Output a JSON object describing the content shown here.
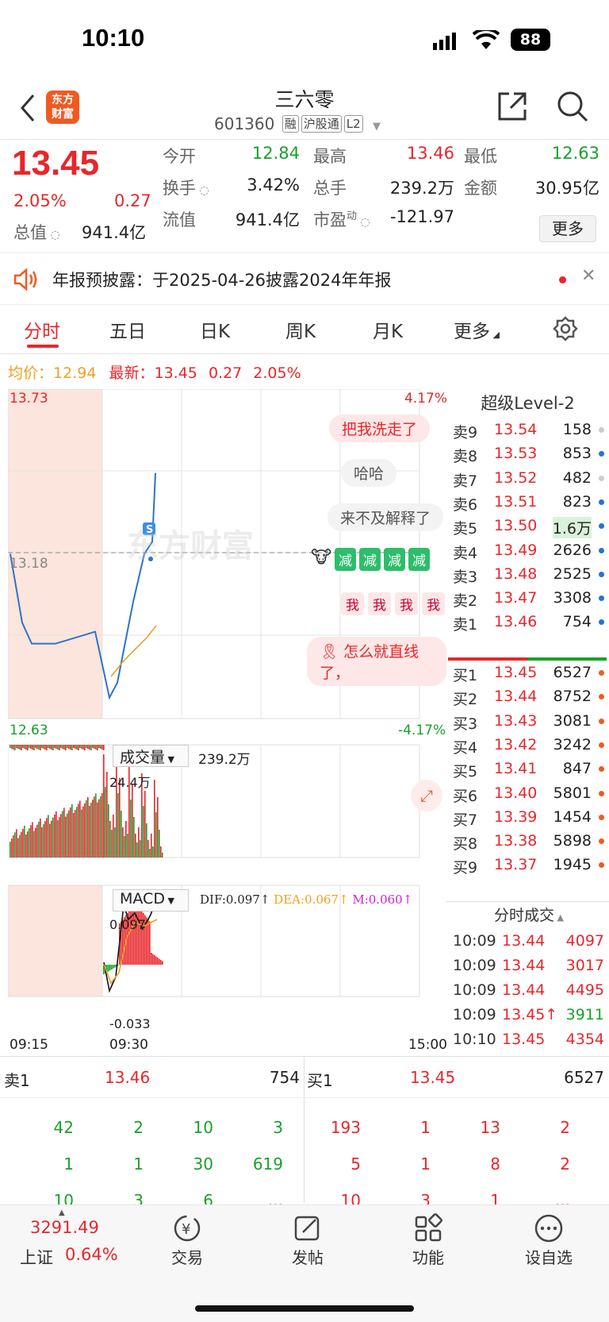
{
  "status": {
    "time": "10:10",
    "battery": "88"
  },
  "header": {
    "logo_line1": "东方",
    "logo_line2": "财富",
    "name": "三六零",
    "code": "601360",
    "tags": [
      "融",
      "沪股通",
      "L2"
    ]
  },
  "quote": {
    "price": "13.45",
    "pct": "2.05%",
    "change": "0.27",
    "stats": [
      {
        "label": "今开",
        "value": "12.84",
        "color": "#17a12b"
      },
      {
        "label": "最高",
        "value": "13.46",
        "color": "#e8262a"
      },
      {
        "label": "最低",
        "value": "12.63",
        "color": "#17a12b"
      },
      {
        "label": "换手",
        "value": "3.42%",
        "color": "#222"
      },
      {
        "label": "总手",
        "value": "239.2万",
        "color": "#222"
      },
      {
        "label": "金额",
        "value": "30.95亿",
        "color": "#222"
      },
      {
        "label": "总值",
        "value": "941.4亿",
        "color": "#222"
      },
      {
        "label": "流值",
        "value": "941.4亿",
        "color": "#222"
      },
      {
        "label": "市盈",
        "label_sup": "动",
        "value": "-121.97",
        "color": "#222"
      }
    ],
    "more": "更多"
  },
  "notice": {
    "text": "年报预披露：于2025-04-26披露2024年年报"
  },
  "tabs": [
    "分时",
    "五日",
    "日K",
    "周K",
    "月K",
    "更多"
  ],
  "avgline": {
    "avg_label": "均价：",
    "avg": "12.94",
    "last_label": "最新：",
    "last": "13.45",
    "chg": "0.27",
    "pct": "2.05%"
  },
  "chart": {
    "ymax": "13.73",
    "ymid": "13.18",
    "ymin": "12.63",
    "pmax": "4.17%",
    "pmin": "-4.17%",
    "vol_label": "成交量",
    "vol_total": "239.2万",
    "vol_max": "24.4万",
    "macd_label": "MACD",
    "dif": "DIF:0.097",
    "dea": "DEA:0.067",
    "m": "M:0.060",
    "macd_max": "0.097",
    "macd_min": "-0.033",
    "t_start": "09:15",
    "t_open": "09:30",
    "t_end": "15:00",
    "watermark": "东方财富",
    "comments": [
      "把我洗走了",
      "哈哈",
      "来不及解释了",
      "减",
      "减",
      "减",
      "减",
      "我",
      "我",
      "我",
      "我",
      "怎么就直线了，"
    ]
  },
  "level2": {
    "title": "超级Level-2",
    "asks": [
      [
        "卖9",
        "13.54",
        "158"
      ],
      [
        "卖8",
        "13.53",
        "853"
      ],
      [
        "卖7",
        "13.52",
        "482"
      ],
      [
        "卖6",
        "13.51",
        "823"
      ],
      [
        "卖5",
        "13.50",
        "1.6万"
      ],
      [
        "卖4",
        "13.49",
        "2626"
      ],
      [
        "卖3",
        "13.48",
        "2525"
      ],
      [
        "卖2",
        "13.47",
        "3308"
      ],
      [
        "卖1",
        "13.46",
        "754"
      ]
    ],
    "bids": [
      [
        "买1",
        "13.45",
        "6527"
      ],
      [
        "买2",
        "13.44",
        "8752"
      ],
      [
        "买3",
        "13.43",
        "3081"
      ],
      [
        "买4",
        "13.42",
        "3242"
      ],
      [
        "买5",
        "13.41",
        "847"
      ],
      [
        "买6",
        "13.40",
        "5801"
      ],
      [
        "买7",
        "13.39",
        "1454"
      ],
      [
        "买8",
        "13.38",
        "5898"
      ],
      [
        "买9",
        "13.37",
        "1945"
      ]
    ],
    "trades_title": "分时成交",
    "trades": [
      [
        "10:09",
        "13.44",
        "4097"
      ],
      [
        "10:09",
        "13.44",
        "3017"
      ],
      [
        "10:09",
        "13.44",
        "4495"
      ],
      [
        "10:09",
        "13.45↑",
        "3911"
      ],
      [
        "10:10",
        "13.45",
        "4354"
      ]
    ]
  },
  "queue": {
    "ask_label": "卖1",
    "ask_price": "13.46",
    "ask_vol": "754",
    "bid_label": "买1",
    "bid_price": "13.45",
    "bid_vol": "6527",
    "ask_rows": [
      [
        "42",
        "2",
        "10",
        "3"
      ],
      [
        "1",
        "1",
        "30",
        "619"
      ],
      [
        "10",
        "3",
        "6",
        "..."
      ]
    ],
    "bid_rows": [
      [
        "193",
        "1",
        "13",
        "2"
      ],
      [
        "5",
        "1",
        "8",
        "2"
      ],
      [
        "10",
        "3",
        "1",
        "..."
      ]
    ]
  },
  "nav": {
    "index_value": "3291.49",
    "index_name": "上证",
    "index_pct": "0.64%",
    "items": [
      "交易",
      "发帖",
      "功能",
      "设自选"
    ]
  },
  "colors": {
    "up": "#e8262a",
    "down": "#17a12b",
    "accent": "#ef5a23"
  },
  "chart_data": {
    "type": "line",
    "ylim": [
      12.63,
      13.73
    ],
    "series": [
      {
        "name": "价格",
        "values": [
          13.18,
          12.95,
          12.88,
          12.88,
          12.88,
          12.92,
          12.7,
          12.75,
          13.02,
          13.18,
          13.22,
          13.45
        ]
      },
      {
        "name": "均价",
        "values": [
          12.77,
          12.82,
          12.86,
          12.9,
          12.94
        ]
      }
    ]
  }
}
